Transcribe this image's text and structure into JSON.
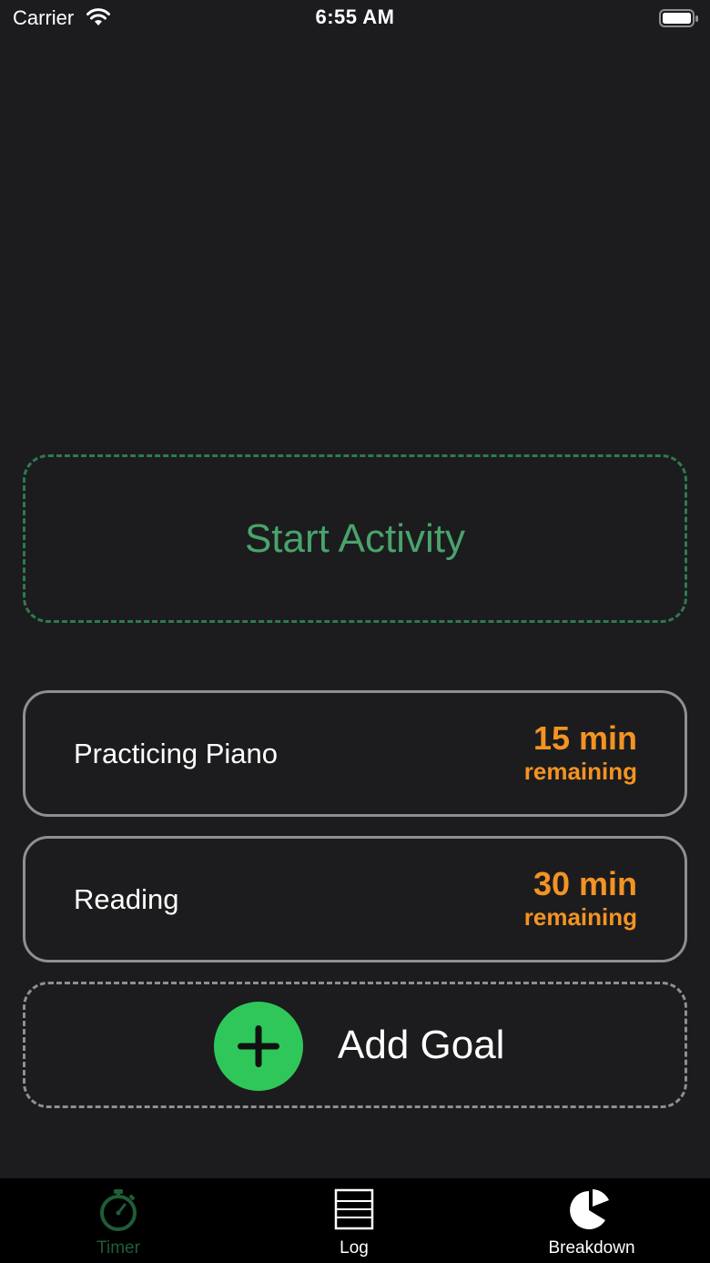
{
  "status_bar": {
    "carrier": "Carrier",
    "time": "6:55 AM"
  },
  "start_activity": {
    "label": "Start Activity",
    "color": "#4aa36c"
  },
  "goals": [
    {
      "name": "Practicing Piano",
      "amount": "15 min",
      "remaining_label": "remaining"
    },
    {
      "name": "Reading",
      "amount": "30 min",
      "remaining_label": "remaining"
    }
  ],
  "add_goal": {
    "label": "Add Goal",
    "icon": "plus-circle-icon",
    "color": "#30c75a"
  },
  "tab_bar": {
    "tabs": [
      {
        "label": "Timer",
        "icon": "stopwatch-icon",
        "selected": true
      },
      {
        "label": "Log",
        "icon": "list-icon",
        "selected": false
      },
      {
        "label": "Breakdown",
        "icon": "pie-chart-icon",
        "selected": false
      }
    ]
  },
  "colors": {
    "background": "#1c1c1e",
    "accent_orange": "#f39323",
    "selected_tab": "#1f5c38"
  }
}
